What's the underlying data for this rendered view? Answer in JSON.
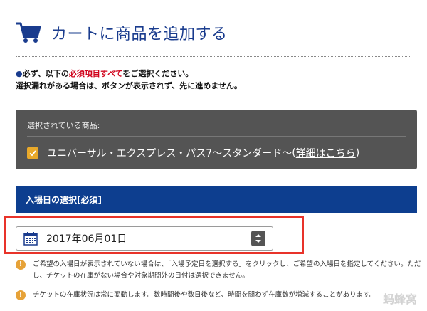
{
  "header": {
    "title": "カートに商品を追加する",
    "icon": "shopping-cart-icon"
  },
  "notice": {
    "line1_prefix": "必ず、以下の",
    "line1_red": "必須項目すべて",
    "line1_suffix": "をご選択ください。",
    "line2": "選択漏れがある場合は、ボタンが表示されず、先に進めません。"
  },
  "selected": {
    "label": "選択されている商品:",
    "product_name": "ユニバーサル・エクスプレス・パス7〜スタンダード〜",
    "link_open": "(",
    "link_text": "詳細はこちら",
    "link_close": ")"
  },
  "date_section": {
    "header": "入場日の選択[必須]",
    "selected_value": "2017年06月01日"
  },
  "info": [
    {
      "text": "ご希望の入場日が表示されていない場合は、「入場予定日を選択する」をクリックし、ご希望の入場日を指定してください。ただし、チケットの在庫がない場合や対象期間外の日付は選択できません。"
    },
    {
      "text": "チケットの在庫状況は常に変動します。数時間後や数日後など、時間を問わず在庫数が増減することがあります。"
    }
  ],
  "watermark": "蚂蜂窝",
  "colors": {
    "brand_blue": "#1a3c8e",
    "section_blue": "#0d3e8f",
    "panel_gray": "#545454",
    "highlight_red": "#e8332a",
    "check_orange": "#e9a92a"
  }
}
